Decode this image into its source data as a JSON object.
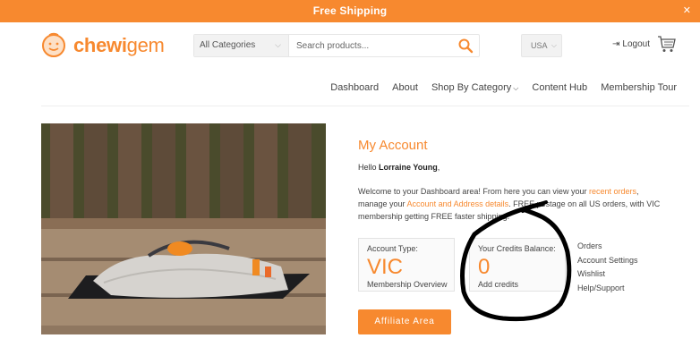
{
  "topbar": {
    "text": "Free Shipping",
    "close": "✕"
  },
  "brand": {
    "name_part1": "chewi",
    "name_part2": "gem",
    "logo_icon": "smiley-face-logo"
  },
  "search": {
    "category": "All Categories",
    "placeholder": "Search products...",
    "chevron": "⌵",
    "icon": "search-icon"
  },
  "country": {
    "value": "USA",
    "chevron": "⌵"
  },
  "header": {
    "logout_label": "Logout",
    "logout_icon": "⇥",
    "cart_icon": "cart-icon"
  },
  "nav": {
    "items": [
      {
        "label": "Dashboard"
      },
      {
        "label": "About"
      },
      {
        "label": "Shop By Category",
        "chevron": "⌵"
      },
      {
        "label": "Content Hub"
      },
      {
        "label": "Membership Tour"
      }
    ]
  },
  "account": {
    "title": "My Account",
    "hello_prefix": "Hello ",
    "user_name": "Lorraine Young",
    "hello_suffix": ",",
    "welcome": {
      "p1": "Welcome to your Dashboard area! From here you can view your ",
      "recent_orders": "recent orders",
      "p2": ", manage your ",
      "account_details": "Account and Address details",
      "p3": ". FREE postage on all US orders, with VIC membership getting FREE faster shipping."
    }
  },
  "cards": {
    "account_type": {
      "label": "Account Type:",
      "value": "VIC",
      "link": "Membership Overview"
    },
    "credits": {
      "label": "Your Credits Balance:",
      "value": "0",
      "link": "Add credits"
    }
  },
  "side_links": [
    "Orders",
    "Account Settings",
    "Wishlist",
    "Help/Support"
  ],
  "affiliate": {
    "label": "Affiliate Area"
  },
  "colors": {
    "accent": "#f7892f",
    "text": "#444444",
    "card_bg": "#fafafa"
  }
}
